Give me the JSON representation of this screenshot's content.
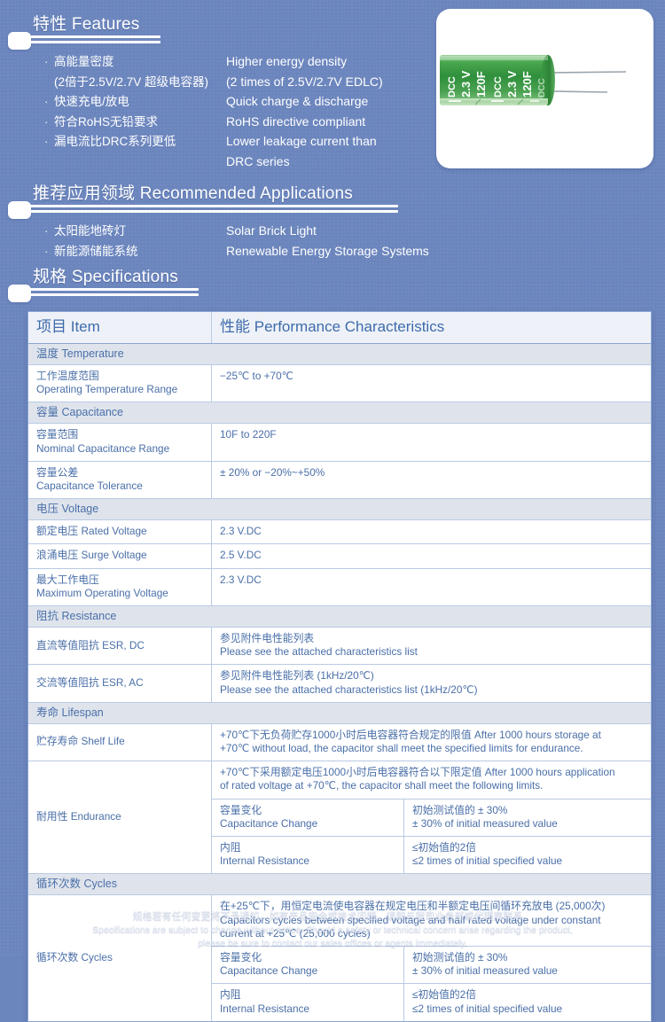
{
  "sections": {
    "features": {
      "title_cn": "特性",
      "title_en": "Features",
      "items": [
        {
          "cn": "高能量密度",
          "en": "Higher energy density"
        },
        {
          "cn": "(2倍于2.5V/2.7V 超级电容器)",
          "en": "(2 times of 2.5V/2.7V EDLC)"
        },
        {
          "cn": "快速充电/放电",
          "en": "Quick charge & discharge"
        },
        {
          "cn": "符合RoHS无铅要求",
          "en": "RoHS directive compliant"
        },
        {
          "cn": "漏电流比DRC系列更低",
          "en": "Lower leakage current than"
        },
        {
          "cn": "",
          "en": "DRC series"
        }
      ]
    },
    "applications": {
      "title_cn": "推荐应用领域",
      "title_en": "Recommended Applications",
      "items": [
        {
          "cn": "太阳能地砖灯",
          "en": "Solar Brick Light"
        },
        {
          "cn": "新能源储能系统",
          "en": "Renewable Energy Storage Systems"
        }
      ]
    },
    "specifications": {
      "title_cn": "规格",
      "title_en": "Specifications"
    }
  },
  "product_photo": {
    "label_line1": "DCC",
    "label_line2": "2.3 V",
    "label_line3": "120F",
    "body_color": "#3e9b46",
    "alt": "green cylindrical EDLC supercapacitor with radial leads"
  },
  "table": {
    "header": {
      "item_cn": "项目",
      "item_en": "Item",
      "perf_cn": "性能",
      "perf_en": "Performance Characteristics"
    },
    "sections": [
      {
        "section_cn": "温度",
        "section_en": "Temperature",
        "rows": [
          {
            "item_cn": "工作温度范围",
            "item_en": "Operating Temperature Range",
            "value_cn": "",
            "value_en": "−25℃ to +70℃"
          }
        ]
      },
      {
        "section_cn": "容量",
        "section_en": "Capacitance",
        "rows": [
          {
            "item_cn": "容量范围",
            "item_en": "Nominal Capacitance Range",
            "value_cn": "",
            "value_en": "10F to 220F"
          },
          {
            "item_cn": "容量公差",
            "item_en": "Capacitance Tolerance",
            "value_cn": "",
            "value_en": "± 20% or −20%~+50%"
          }
        ]
      },
      {
        "section_cn": "电压",
        "section_en": "Voltage",
        "rows": [
          {
            "item_cn": "额定电压",
            "item_en": "Rated Voltage",
            "inline": true,
            "value_cn": "",
            "value_en": "2.3 V.DC"
          },
          {
            "item_cn": "浪涌电压",
            "item_en": "Surge Voltage",
            "inline": true,
            "value_cn": "",
            "value_en": "2.5 V.DC"
          },
          {
            "item_cn": "最大工作电压",
            "item_en": "Maximum Operating Voltage",
            "value_cn": "",
            "value_en": "2.3 V.DC"
          }
        ]
      },
      {
        "section_cn": "阻抗",
        "section_en": "Resistance",
        "rows": [
          {
            "item_cn": "直流等值阻抗",
            "item_en": "ESR, DC",
            "inline": true,
            "value_cn": "参见附件电性能列表",
            "value_en": "Please see the attached characteristics list"
          },
          {
            "item_cn": "交流等值阻抗",
            "item_en": "ESR, AC",
            "inline": true,
            "value_cn": "参见附件电性能列表 (1kHz/20℃)",
            "value_en": "Please see the attached characteristics list (1kHz/20℃)"
          }
        ]
      },
      {
        "section_cn": "寿命",
        "section_en": "Lifespan",
        "rows": [
          {
            "item_cn": "贮存寿命",
            "item_en": "Shelf Life",
            "inline": true,
            "value_cn": "+70℃下无负荷贮存1000小时后电容器符合规定的限值 After 1000 hours storage at",
            "value_en": "+70℃ without load, the capacitor shall meet the specified limits for endurance."
          }
        ],
        "nested_row": {
          "item_cn": "耐用性",
          "item_en": "Endurance",
          "inline": true,
          "desc_cn": "+70℃下采用额定电压1000小时后电容器符合以下限定值 After 1000 hours application",
          "desc_en": "of rated voltage at +70℃, the capacitor shall meet the following limits.",
          "sub_rows": [
            {
              "key_cn": "容量变化",
              "key_en": "Capacitance Change",
              "val_cn": "初始测试值的 ± 30%",
              "val_en": "± 30% of initial measured value"
            },
            {
              "key_cn": "内阻",
              "key_en": "Internal Resistance",
              "val_cn": "≤初始值的2倍",
              "val_en": "≤2 times of initial specified value"
            }
          ]
        }
      },
      {
        "section_cn": "循环次数",
        "section_en": "Cycles",
        "rows": [],
        "nested_row": {
          "item_cn": "循环次数",
          "item_en": "Cycles",
          "inline": true,
          "desc_cn": "在+25℃下，用恒定电流使电容器在规定电压和半额定电压间循环充放电 (25,000次)",
          "desc_en": "Capacitors cycles between specified voltage and half rated voltage under constant",
          "desc_en2": "current at +25℃ (25,000 cycles)",
          "sub_rows": [
            {
              "key_cn": "容量变化",
              "key_en": "Capacitance Change",
              "val_cn": "初始测试值的 ± 30%",
              "val_en": "± 30% of initial measured value"
            },
            {
              "key_cn": "内阻",
              "key_en": "Internal Resistance",
              "val_cn": "≤初始值的2倍",
              "val_en": "≤2 times of initial specified value"
            }
          ]
        }
      }
    ]
  },
  "footer": {
    "line_cn": "规格若有任何变更将不予通知。如有产品安全或技术问题，请即与我司业务部或代理商联系。",
    "line_en1": "Specifications are subject to change without notice. Should a safety or technical concern arise regarding the product,",
    "line_en2": "please be sure to contact our sales offices or agents immediately."
  },
  "colors": {
    "background": "#6b85bd",
    "table_text": "#4a6fa8",
    "table_header_text": "#3f6bab",
    "section_row_bg": "#dfe4ec",
    "border": "#b9cae4"
  }
}
